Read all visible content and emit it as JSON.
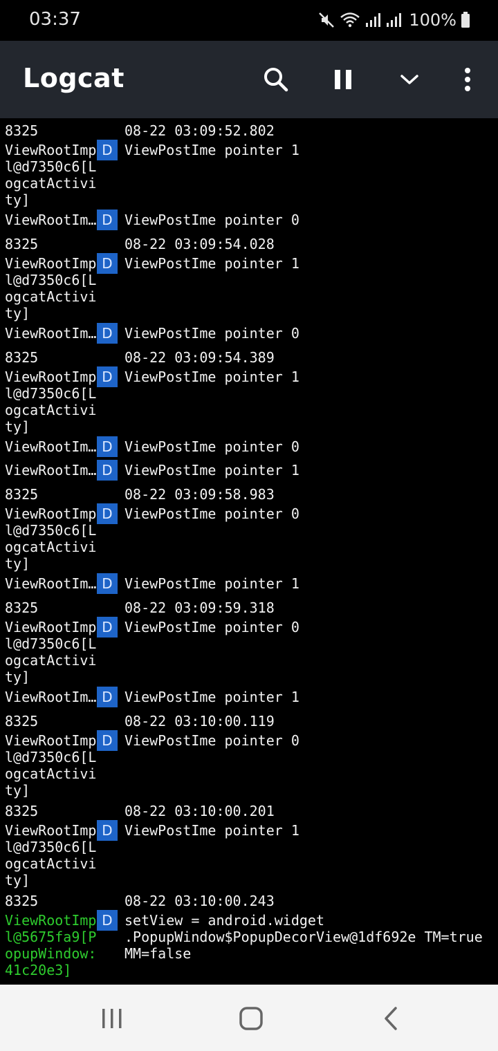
{
  "status_bar": {
    "time": "03:37",
    "battery": "100%",
    "icons": [
      "mute-icon",
      "wifi-icon",
      "signal-icon",
      "signal-icon",
      "battery-icon"
    ]
  },
  "app_bar": {
    "title": "Logcat",
    "actions": [
      "search-icon",
      "pause-icon",
      "chevron-down-icon",
      "more-vert-icon"
    ]
  },
  "colors": {
    "app_bar_bg": "#23272e",
    "badge_bg": "#1e64c8",
    "highlight_tag": "#2ecc2e",
    "nav_bg": "#f4f4f4"
  },
  "log": {
    "entries": [
      {
        "pid": "8325",
        "time": "08-22 03:09:52.802",
        "tag": "ViewRootImp\nl@d7350c6[L\nogcatActivi\nty]",
        "level": "D",
        "message": "ViewPostIme pointer 1"
      },
      {
        "tag": "ViewRootIm…",
        "level": "D",
        "message": "ViewPostIme pointer 0"
      },
      {
        "pid": "8325",
        "time": "08-22 03:09:54.028",
        "tag": "ViewRootImp\nl@d7350c6[L\nogcatActivi\nty]",
        "level": "D",
        "message": "ViewPostIme pointer 1"
      },
      {
        "tag": "ViewRootIm…",
        "level": "D",
        "message": "ViewPostIme pointer 0"
      },
      {
        "pid": "8325",
        "time": "08-22 03:09:54.389",
        "tag": "ViewRootImp\nl@d7350c6[L\nogcatActivi\nty]",
        "level": "D",
        "message": "ViewPostIme pointer 1"
      },
      {
        "tag": "ViewRootIm…",
        "level": "D",
        "message": "ViewPostIme pointer 0"
      },
      {
        "tag": "ViewRootIm…",
        "level": "D",
        "message": "ViewPostIme pointer 1"
      },
      {
        "pid": "8325",
        "time": "08-22 03:09:58.983",
        "tag": "ViewRootImp\nl@d7350c6[L\nogcatActivi\nty]",
        "level": "D",
        "message": "ViewPostIme pointer 0"
      },
      {
        "tag": "ViewRootIm…",
        "level": "D",
        "message": "ViewPostIme pointer 1"
      },
      {
        "pid": "8325",
        "time": "08-22 03:09:59.318",
        "tag": "ViewRootImp\nl@d7350c6[L\nogcatActivi\nty]",
        "level": "D",
        "message": "ViewPostIme pointer 0"
      },
      {
        "tag": "ViewRootIm…",
        "level": "D",
        "message": "ViewPostIme pointer 1"
      },
      {
        "pid": "8325",
        "time": "08-22 03:10:00.119",
        "tag": "ViewRootImp\nl@d7350c6[L\nogcatActivi\nty]",
        "level": "D",
        "message": "ViewPostIme pointer 0"
      },
      {
        "pid": "8325",
        "time": "08-22 03:10:00.201",
        "tag": "ViewRootImp\nl@d7350c6[L\nogcatActivi\nty]",
        "level": "D",
        "message": "ViewPostIme pointer 1"
      },
      {
        "pid": "8325",
        "time": "08-22 03:10:00.243",
        "tag": "ViewRootImp\nl@5675fa9[P\nopupWindow:\n41c20e3]",
        "level": "D",
        "message": "setView = android.widget\n.PopupWindow$PopupDecorView@1df692e TM=true\nMM=false",
        "highlight": true
      }
    ]
  },
  "nav_bar": {
    "buttons": [
      "recents-icon",
      "home-icon",
      "back-icon"
    ]
  }
}
